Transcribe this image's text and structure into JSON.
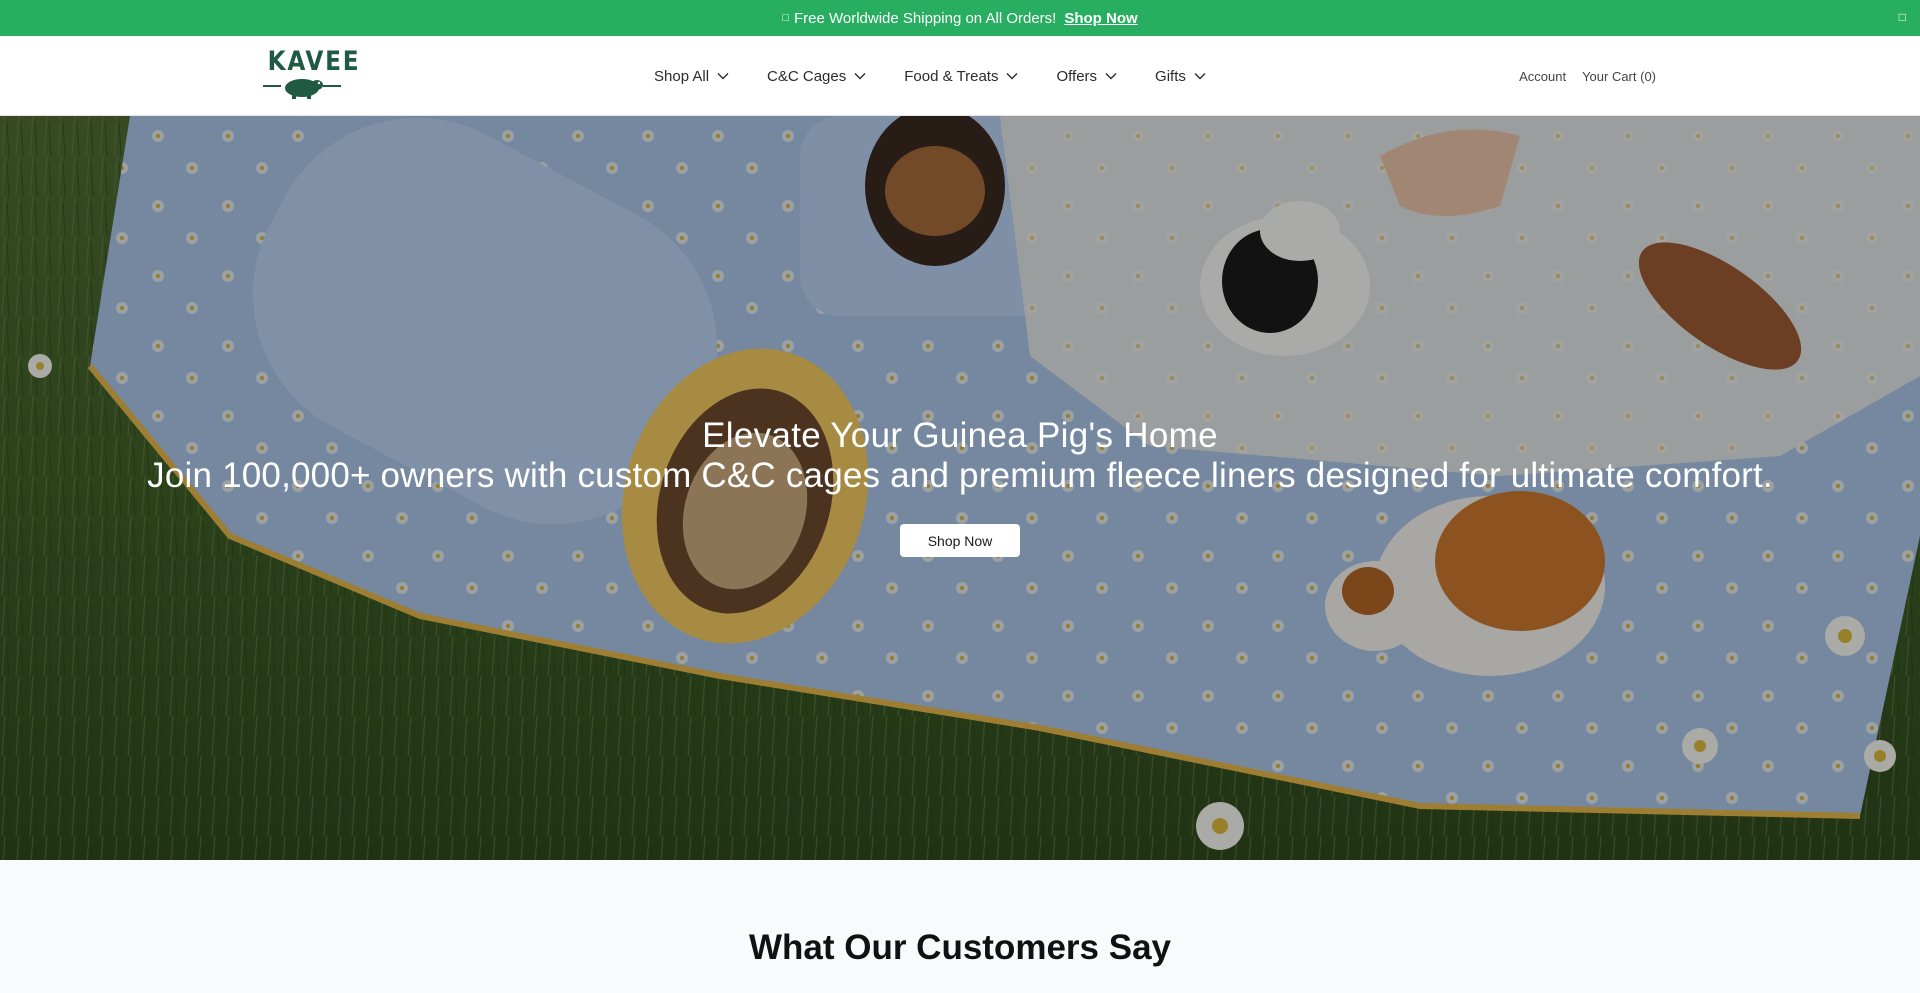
{
  "announcement": {
    "glyph": "□",
    "text": "Free Worldwide Shipping on All Orders!",
    "link": "Shop Now",
    "close": "□"
  },
  "header": {
    "logo_text": "KAVEE",
    "logo_icon": "guinea-pig-icon",
    "brand_color": "#1f5a42",
    "nav": [
      {
        "label": "Shop All",
        "icon": "chevron-down-icon"
      },
      {
        "label": "C&C Cages",
        "icon": "chevron-down-icon"
      },
      {
        "label": "Food & Treats",
        "icon": "chevron-down-icon"
      },
      {
        "label": "Offers",
        "icon": "chevron-down-icon"
      },
      {
        "label": "Gifts",
        "icon": "chevron-down-icon"
      }
    ],
    "account": "Account",
    "cart": "Your Cart (0)"
  },
  "hero": {
    "title": "Elevate Your Guinea Pig's Home",
    "subtitle": "Join 100,000+ owners with custom C&C cages and premium fleece liners designed for ultimate comfort.",
    "button": "Shop Now"
  },
  "testimonials": {
    "heading": "What Our Customers Say"
  },
  "colors": {
    "announcement_bg": "#27ae60",
    "testimonials_bg": "#f9fafb"
  }
}
